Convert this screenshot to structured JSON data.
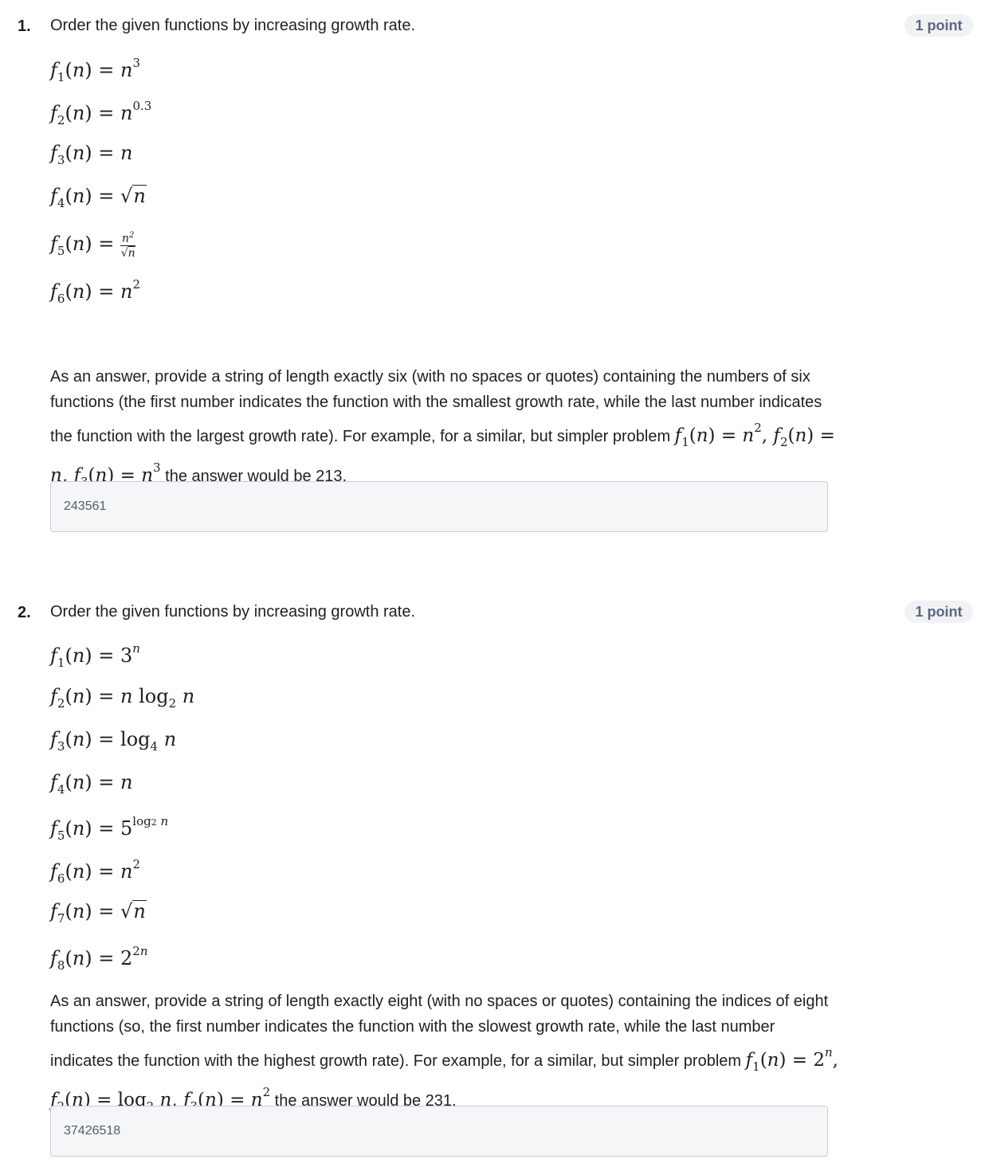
{
  "q1": {
    "number": "1.",
    "title": "Order the given functions by increasing growth rate.",
    "points": "1 point",
    "instructions": "As an answer, provide a string of length exactly six (with no spaces or quotes) containing the numbers of six functions (the first number indicates the function with the smallest growth rate, while the last number indicates the function with the largest growth rate). For example, for a similar, but simpler problem",
    "example_end": "the answer would be 213.",
    "answer": "243561"
  },
  "q2": {
    "number": "2.",
    "title": "Order the given functions by increasing growth rate.",
    "points": "1 point",
    "instructions": "As an answer, provide a string of length exactly eight (with no spaces or quotes) containing the indices of eight functions (so, the first number indicates the function with the slowest growth rate, while the last number indicates the function with the highest growth rate). For example, for a similar, but simpler problem",
    "example_end": "the answer would be 231.",
    "answer": "37426518"
  }
}
